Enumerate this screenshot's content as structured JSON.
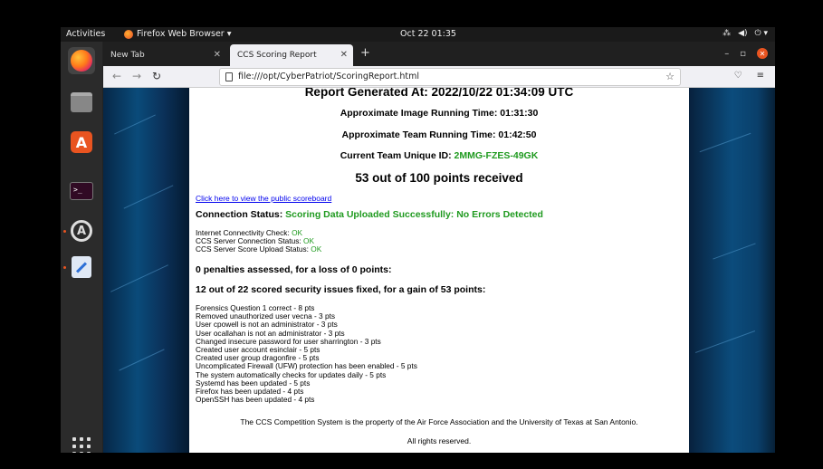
{
  "topbar": {
    "activities": "Activities",
    "app_name": "Firefox Web Browser ▾",
    "clock": "Oct 22  01:35"
  },
  "browser": {
    "tabs": [
      {
        "label": "New Tab"
      },
      {
        "label": "CCS Scoring Report"
      }
    ],
    "url": "file:///opt/CyberPatriot/ScoringReport.html"
  },
  "report": {
    "generated": "Report Generated At: 2022/10/22 01:34:09 UTC",
    "image_time": "Approximate Image Running Time: 01:31:30",
    "team_time": "Approximate Team Running Time: 01:42:50",
    "team_id_label": "Current Team Unique ID: ",
    "team_id": "2MMG-FZES-49GK",
    "points": "53 out of 100 points received",
    "scoreboard_link": "Click here to view the public scoreboard",
    "connection_label": "Connection Status: ",
    "connection_value": "Scoring Data Uploaded Successfully: No Errors Detected",
    "checks": [
      {
        "label": "Internet Connectivity Check: ",
        "value": "OK"
      },
      {
        "label": "CCS Server Connection Status: ",
        "value": "OK"
      },
      {
        "label": "CCS Server Score Upload Status: ",
        "value": "OK"
      }
    ],
    "penalties": "0 penalties assessed, for a loss of 0 points:",
    "issues_fixed": "12 out of 22 scored security issues fixed, for a gain of 53 points:",
    "items": [
      "Forensics Question 1 correct - 8 pts",
      "Removed unauthorized user vecna - 3 pts",
      "User cpowell is not an administrator - 3 pts",
      "User ocallahan is not an administrator - 3 pts",
      "Changed insecure password for user sharrington - 3 pts",
      "Created user account esinclair - 5 pts",
      "Created user group dragonfire - 5 pts",
      "Uncomplicated Firewall (UFW) protection has been enabled - 5 pts",
      "The system automatically checks for updates daily - 5 pts",
      "Systemd has been updated - 5 pts",
      "Firefox has been updated - 4 pts",
      "OpenSSH has been updated - 4 pts"
    ],
    "footer_1": "The CCS Competition System is the property of the Air Force Association and the University of Texas at San Antonio.",
    "footer_2": "All rights reserved."
  },
  "colors": {
    "accent": "#e95420",
    "ok_green": "#1f9a1f",
    "link": "#0000ee"
  }
}
